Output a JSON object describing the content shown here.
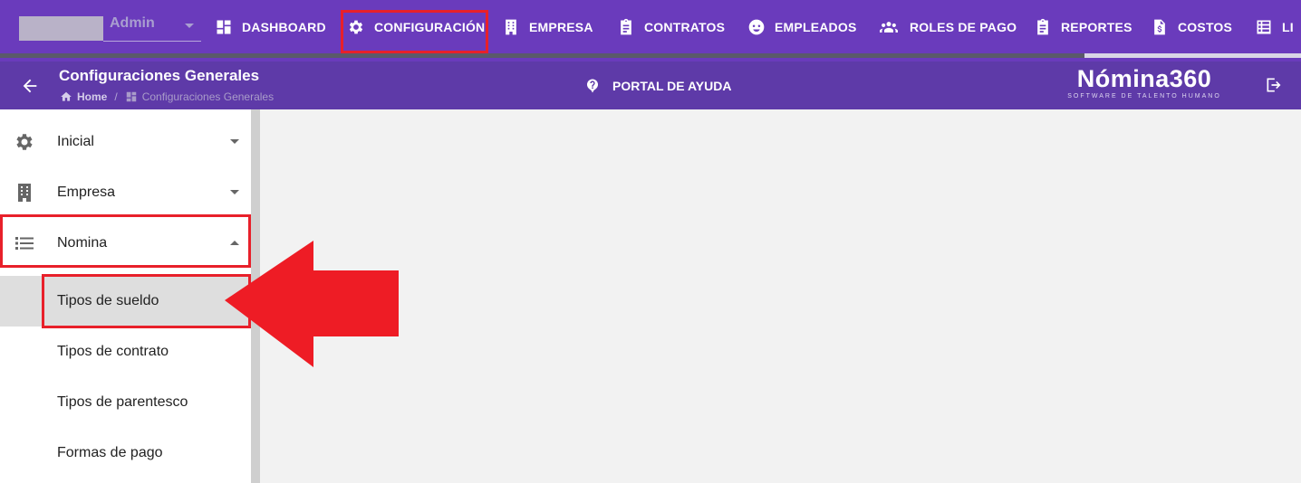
{
  "topbar": {
    "user": {
      "name": "Admin"
    },
    "nav": [
      {
        "label": "DASHBOARD",
        "icon": "dashboard-icon"
      },
      {
        "label": "CONFIGURACIÓN",
        "icon": "gear-icon",
        "active": true
      },
      {
        "label": "EMPRESA",
        "icon": "building-icon"
      },
      {
        "label": "CONTRATOS",
        "icon": "clipboard-icon"
      },
      {
        "label": "EMPLEADOS",
        "icon": "face-icon"
      },
      {
        "label": "ROLES DE PAGO",
        "icon": "group-icon"
      },
      {
        "label": "REPORTES",
        "icon": "clipboard-icon"
      },
      {
        "label": "COSTOS",
        "icon": "cost-file-icon"
      },
      {
        "label": "LI",
        "icon": "list-icon"
      }
    ]
  },
  "header": {
    "title": "Configuraciones Generales",
    "breadcrumb": {
      "home": "Home",
      "separator": "/",
      "current": "Configuraciones Generales"
    },
    "help_label": "PORTAL DE AYUDA",
    "logo": {
      "main": "Nómina360",
      "sub": "SOFTWARE DE TALENTO HUMANO"
    }
  },
  "sidebar": {
    "items": [
      {
        "label": "Inicial",
        "icon": "gear-icon",
        "expanded": false
      },
      {
        "label": "Empresa",
        "icon": "building-icon",
        "expanded": false
      },
      {
        "label": "Nomina",
        "icon": "list-icon",
        "expanded": true
      }
    ],
    "subitems": [
      {
        "label": "Tipos de sueldo",
        "active": true
      },
      {
        "label": "Tipos de contrato"
      },
      {
        "label": "Tipos de parentesco"
      },
      {
        "label": "Formas de pago"
      }
    ]
  },
  "colors": {
    "topbar": "#6a3bbc",
    "subbar": "#5e3aa8",
    "highlight": "#e8202a",
    "arrow": "#ee1c25"
  }
}
